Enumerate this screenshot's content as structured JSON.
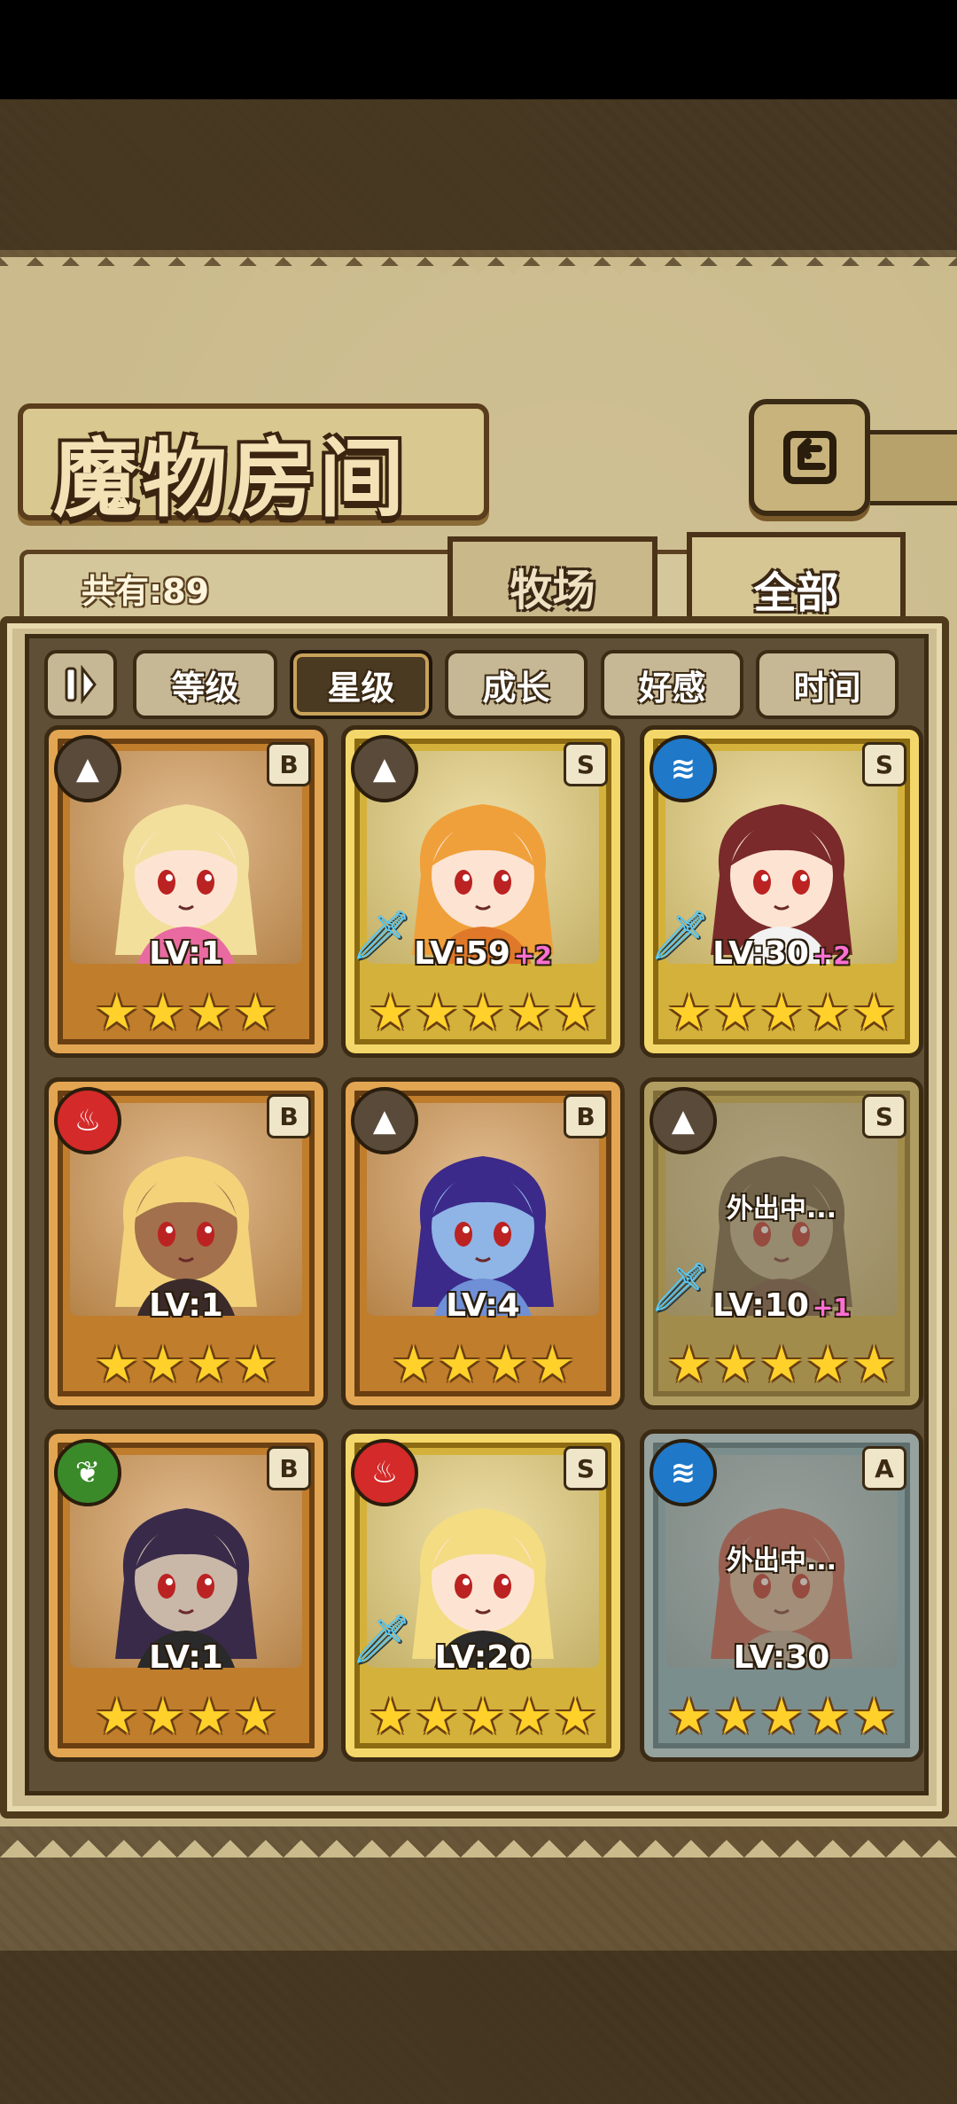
{
  "title": "魔物房间",
  "count": "共有:89",
  "tabs": [
    {
      "label": "牧场",
      "active": false
    },
    {
      "label": "全部",
      "active": true
    }
  ],
  "sort": {
    "toggle_icon": "pause-sort-icon",
    "buttons": [
      {
        "label": "等级",
        "active": false
      },
      {
        "label": "星级",
        "active": true
      },
      {
        "label": "成长",
        "active": false
      },
      {
        "label": "好感",
        "active": false
      },
      {
        "label": "时间",
        "active": false
      }
    ]
  },
  "monsters": [
    {
      "element": "earth",
      "rank": "B",
      "frame": "bronze",
      "level": "LV:1",
      "plus": "",
      "stars": 4,
      "sword": false,
      "away": "",
      "hair": "#f3df9c",
      "skin": "#fde4d2",
      "cloth": "#e86aa0"
    },
    {
      "element": "earth",
      "rank": "S",
      "frame": "gold",
      "level": "LV:59",
      "plus": "+2",
      "stars": 5,
      "sword": true,
      "away": "",
      "hair": "#f0a03a",
      "skin": "#fde4d2",
      "cloth": "#e0782a"
    },
    {
      "element": "water",
      "rank": "S",
      "frame": "gold",
      "level": "LV:30",
      "plus": "+2",
      "stars": 5,
      "sword": true,
      "away": "",
      "hair": "#7a2a2a",
      "skin": "#fde4d2",
      "cloth": "#f2f2f2"
    },
    {
      "element": "fire",
      "rank": "B",
      "frame": "bronze",
      "level": "LV:1",
      "plus": "",
      "stars": 4,
      "sword": false,
      "away": "",
      "hair": "#f3d27a",
      "skin": "#a2704c",
      "cloth": "#3a2a2a"
    },
    {
      "element": "earth",
      "rank": "B",
      "frame": "bronze",
      "level": "LV:4",
      "plus": "",
      "stars": 4,
      "sword": false,
      "away": "",
      "hair": "#3b2a8a",
      "skin": "#8fb4e6",
      "cloth": "#6f8fd6"
    },
    {
      "element": "earth",
      "rank": "S",
      "frame": "gold",
      "level": "LV:10",
      "plus": "+1",
      "stars": 5,
      "sword": true,
      "away": "外出中...",
      "hair": "#6a5a3a",
      "skin": "#bdb08a",
      "cloth": "#6a4a3a"
    },
    {
      "element": "grass",
      "rank": "B",
      "frame": "bronze",
      "level": "LV:1",
      "plus": "",
      "stars": 4,
      "sword": false,
      "away": "",
      "hair": "#3a2a4a",
      "skin": "#c9b7a8",
      "cloth": "#2a2a2a"
    },
    {
      "element": "fire",
      "rank": "S",
      "frame": "gold",
      "level": "LV:20",
      "plus": "",
      "stars": 5,
      "sword": true,
      "away": "",
      "hair": "#f3dc82",
      "skin": "#fde4d2",
      "cloth": "#2a2a2a"
    },
    {
      "element": "water",
      "rank": "A",
      "frame": "blue",
      "level": "LV:30",
      "plus": "",
      "stars": 5,
      "sword": false,
      "away": "外出中...",
      "hair": "#c0504a",
      "skin": "#d6b6a0",
      "cloth": "#b8a89a"
    }
  ],
  "colors": {
    "earth": "#5a4a3a",
    "water": "#1f78c8",
    "fire": "#d42a2a",
    "grass": "#3a8a2a"
  }
}
